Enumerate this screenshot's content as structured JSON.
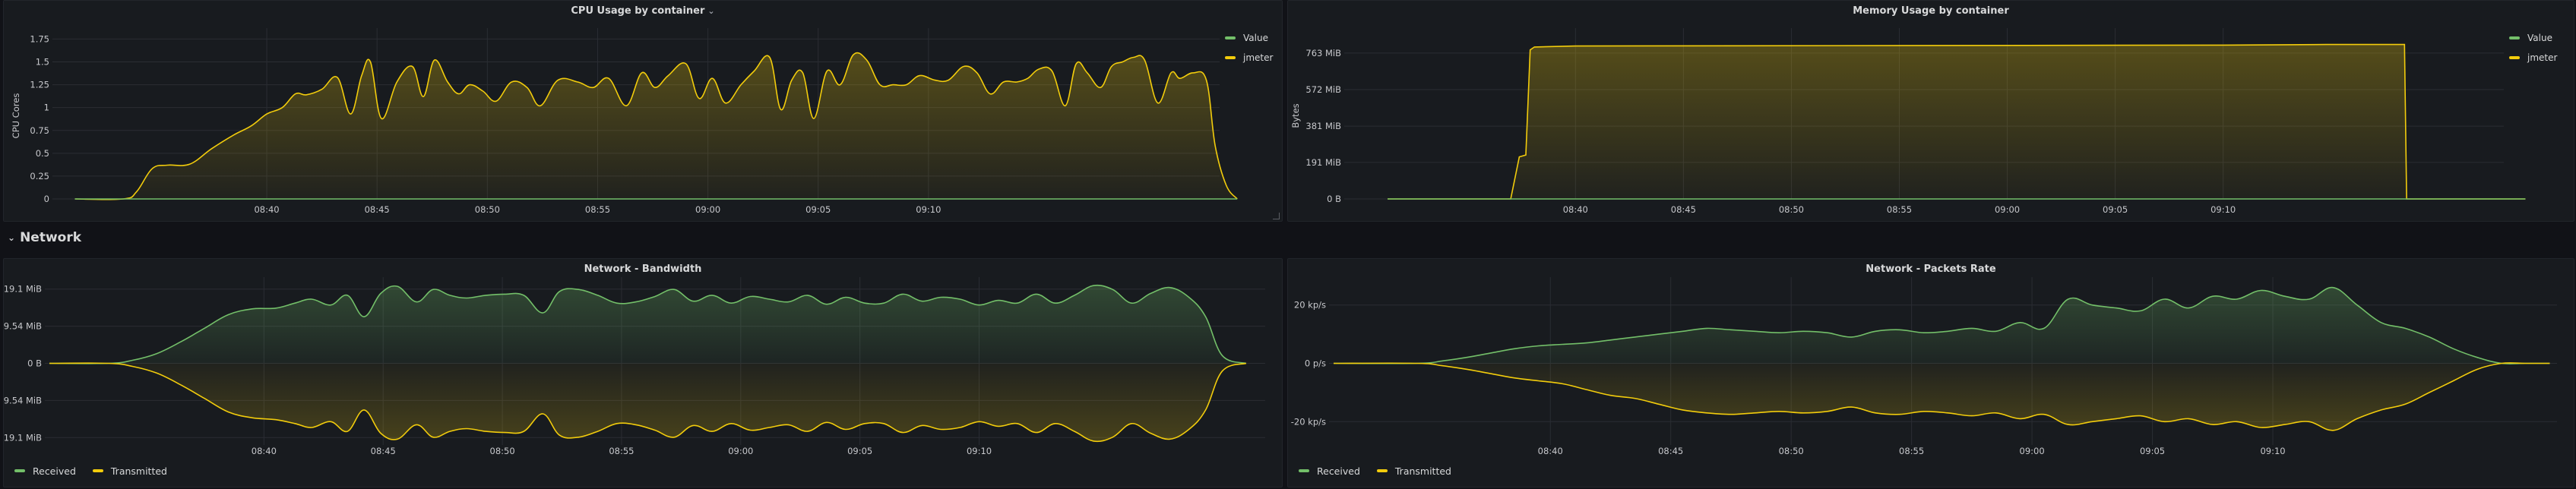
{
  "colors": {
    "green": "#73bf69",
    "yellow": "#f2cc0c",
    "bg": "#111217",
    "panel": "#181b1f"
  },
  "row": {
    "label": "Network",
    "chevron": "⌄"
  },
  "time_ticks": [
    "08:40",
    "08:45",
    "08:50",
    "08:55",
    "09:00",
    "09:05",
    "09:10"
  ],
  "panels": [
    {
      "title": "CPU Usage by container",
      "title_caret": "⌄",
      "ylabel": "CPU Cores",
      "y_ticks": [
        "1.75",
        "1.5",
        "1.25",
        "1",
        "0.75",
        "0.5",
        "0.25",
        "0"
      ],
      "legend": [
        {
          "label": "Value",
          "color": "#73bf69"
        },
        {
          "label": "jmeter",
          "color": "#f2cc0c"
        }
      ]
    },
    {
      "title": "Memory Usage by container",
      "title_caret": "",
      "ylabel": "Bytes",
      "y_ticks": [
        "763 MiB",
        "572 MiB",
        "381 MiB",
        "191 MiB",
        "0 B"
      ],
      "legend": [
        {
          "label": "Value",
          "color": "#73bf69"
        },
        {
          "label": "jmeter",
          "color": "#f2cc0c"
        }
      ]
    },
    {
      "title": "Network - Bandwidth",
      "title_caret": "",
      "ylabel": "",
      "y_ticks": [
        "19.1 MiB",
        "9.54 MiB",
        "0 B",
        "-9.54 MiB",
        "-19.1 MiB"
      ],
      "legend": [
        {
          "label": "Received",
          "color": "#73bf69"
        },
        {
          "label": "Transmitted",
          "color": "#f2cc0c"
        }
      ]
    },
    {
      "title": "Network - Packets Rate",
      "title_caret": "",
      "ylabel": "",
      "y_ticks": [
        "20 kp/s",
        "0 p/s",
        "-20 kp/s"
      ],
      "legend": [
        {
          "label": "Received",
          "color": "#73bf69"
        },
        {
          "label": "Transmitted",
          "color": "#f2cc0c"
        }
      ]
    }
  ],
  "chart_data": [
    {
      "type": "area",
      "title": "CPU Usage by container",
      "ylabel": "CPU Cores",
      "ylim": [
        0,
        1.75
      ],
      "x_minutes_from_0840": [
        -8.7,
        -6.5,
        -5.9,
        -5.2,
        -4.5,
        -3.5,
        -2.5,
        -1.5,
        -0.7,
        0,
        0.7,
        1.3,
        1.8,
        2.5,
        3.2,
        3.8,
        4.3,
        4.7,
        5.2,
        5.9,
        6.6,
        7.1,
        7.6,
        8.2,
        8.7,
        9.2,
        9.8,
        10.4,
        11.1,
        11.8,
        12.4,
        13.2,
        14.1,
        14.8,
        15.5,
        16.3,
        17.0,
        17.6,
        18.2,
        19.0,
        19.6,
        20.2,
        20.8,
        21.5,
        22.1,
        22.8,
        23.3,
        23.8,
        24.3,
        24.8,
        25.4,
        26.0,
        26.6,
        27.2,
        27.8,
        28.4,
        29.0,
        29.6,
        30.3,
        30.9,
        31.6,
        32.2,
        32.8,
        33.4,
        34.0,
        34.5,
        35.0,
        35.6,
        36.2,
        36.7,
        37.2,
        37.8,
        38.3,
        38.8,
        39.3,
        39.8,
        40.4,
        41.0,
        41.4,
        42.0,
        42.6,
        43.0,
        43.5,
        44.0
      ],
      "series": [
        {
          "name": "jmeter",
          "values": [
            0,
            0,
            0.08,
            0.33,
            0.37,
            0.38,
            0.55,
            0.7,
            0.8,
            0.93,
            1.0,
            1.15,
            1.14,
            1.2,
            1.33,
            0.93,
            1.35,
            1.5,
            0.88,
            1.28,
            1.45,
            1.12,
            1.52,
            1.28,
            1.15,
            1.25,
            1.18,
            1.07,
            1.28,
            1.22,
            1.02,
            1.3,
            1.28,
            1.22,
            1.32,
            1.02,
            1.38,
            1.22,
            1.35,
            1.48,
            1.1,
            1.32,
            1.05,
            1.25,
            1.4,
            1.55,
            0.98,
            1.3,
            1.38,
            0.88,
            1.4,
            1.25,
            1.58,
            1.52,
            1.25,
            1.25,
            1.25,
            1.35,
            1.3,
            1.3,
            1.45,
            1.38,
            1.15,
            1.28,
            1.28,
            1.32,
            1.42,
            1.4,
            1.02,
            1.48,
            1.38,
            1.22,
            1.45,
            1.5,
            1.55,
            1.52,
            1.05,
            1.38,
            1.32,
            1.38,
            1.3,
            0.58,
            0.15,
            0
          ]
        },
        {
          "name": "Value",
          "values": [
            0,
            0
          ]
        }
      ]
    },
    {
      "type": "area",
      "title": "Memory Usage by container",
      "ylabel": "Bytes",
      "ylim_mib": [
        0,
        840
      ],
      "x_minutes_from_0840": [
        -8.7,
        -3.0,
        -2.6,
        -2.3,
        -2.1,
        -1.9,
        0,
        30,
        34.8,
        38.3,
        38.4,
        38.5,
        41.0,
        44.0
      ],
      "series": [
        {
          "name": "jmeter",
          "values": [
            0,
            0,
            220,
            230,
            780,
            795,
            800,
            805,
            808,
            808,
            808,
            0,
            0,
            0
          ]
        },
        {
          "name": "Value",
          "values": [
            0,
            0
          ]
        }
      ]
    },
    {
      "type": "area",
      "title": "Network - Bandwidth",
      "ylim_mib": [
        -20,
        20
      ],
      "x_minutes_from_0840": [
        -9.0,
        -6.5,
        -5.5,
        -4.5,
        -3.5,
        -2.5,
        -1.5,
        -0.5,
        0.5,
        1.3,
        2.0,
        2.8,
        3.5,
        4.2,
        4.9,
        5.6,
        6.4,
        7.1,
        7.8,
        8.5,
        9.3,
        10.1,
        10.9,
        11.7,
        12.4,
        13.2,
        14.0,
        14.8,
        15.6,
        16.4,
        17.2,
        18.0,
        18.8,
        19.6,
        20.4,
        21.2,
        22.0,
        22.8,
        23.6,
        24.4,
        25.2,
        26.0,
        26.8,
        27.6,
        28.4,
        29.2,
        30.0,
        30.8,
        31.6,
        32.4,
        33.2,
        34.0,
        34.8,
        35.6,
        36.4,
        37.2,
        38.0,
        38.8,
        39.5,
        40.2,
        41.2
      ],
      "series": [
        {
          "name": "Received",
          "values": [
            0,
            0,
            0.8,
            2.5,
            5.5,
            9.0,
            12.5,
            14.0,
            14.2,
            15.5,
            16.5,
            15.0,
            17.5,
            12.0,
            18.0,
            19.8,
            15.8,
            19.0,
            17.5,
            16.8,
            17.5,
            17.8,
            17.5,
            13.0,
            18.5,
            19.0,
            17.5,
            15.5,
            15.8,
            17.2,
            19.0,
            16.0,
            17.5,
            15.5,
            17.2,
            16.5,
            15.8,
            17.5,
            15.2,
            17.0,
            15.5,
            15.5,
            17.8,
            16.0,
            17.0,
            16.5,
            15.0,
            16.2,
            15.5,
            17.8,
            15.5,
            17.5,
            20.0,
            19.0,
            15.5,
            18.0,
            19.5,
            17.0,
            12.0,
            2.0,
            0
          ]
        },
        {
          "name": "Transmitted",
          "values": [
            0,
            0,
            -0.8,
            -2.5,
            -5.5,
            -9.0,
            -12.5,
            -14.0,
            -14.5,
            -15.5,
            -16.5,
            -15.0,
            -17.5,
            -12.0,
            -18.0,
            -19.5,
            -15.8,
            -19.0,
            -17.5,
            -16.8,
            -17.5,
            -17.8,
            -17.5,
            -13.0,
            -18.5,
            -19.0,
            -17.5,
            -15.5,
            -15.8,
            -17.2,
            -19.0,
            -16.0,
            -17.5,
            -15.5,
            -17.2,
            -16.5,
            -15.8,
            -17.5,
            -15.2,
            -17.0,
            -15.5,
            -15.5,
            -17.8,
            -16.0,
            -17.0,
            -16.5,
            -15.0,
            -16.2,
            -15.5,
            -17.8,
            -15.5,
            -17.5,
            -20.0,
            -19.0,
            -15.5,
            -18.0,
            -19.5,
            -17.0,
            -12.0,
            -2.0,
            0
          ]
        }
      ]
    },
    {
      "type": "area",
      "title": "Network - Packets Rate",
      "ylim_kps": [
        -28,
        28
      ],
      "x_minutes_from_0840": [
        -9.0,
        -5.5,
        -4.5,
        -3.5,
        -2.5,
        -1.5,
        -0.5,
        0.5,
        1.5,
        2.5,
        3.5,
        4.5,
        5.5,
        6.5,
        7.5,
        8.5,
        9.5,
        10.5,
        11.5,
        12.5,
        13.5,
        14.5,
        15.5,
        16.5,
        17.5,
        18.5,
        19.5,
        20.5,
        21.5,
        22.5,
        23.5,
        24.5,
        25.5,
        26.5,
        27.5,
        28.5,
        29.5,
        30.5,
        31.5,
        32.5,
        33.5,
        34.5,
        35.5,
        36.5,
        37.5,
        38.5,
        39.5,
        40.5,
        41.5
      ],
      "series": [
        {
          "name": "Received",
          "values": [
            0,
            0,
            0.8,
            2,
            3.5,
            5,
            6,
            6.5,
            7,
            8,
            9,
            10,
            11,
            12,
            11.5,
            11,
            10.5,
            11,
            10.5,
            9,
            11,
            11.5,
            10.5,
            11,
            12,
            11,
            14,
            12,
            22,
            20,
            19,
            18,
            22,
            19,
            23,
            22,
            25,
            23,
            22,
            26,
            20,
            14,
            12,
            9,
            5,
            2,
            0,
            0,
            0
          ]
        },
        {
          "name": "Transmitted",
          "values": [
            0,
            0,
            -0.8,
            -2,
            -3.5,
            -5,
            -6,
            -7,
            -9,
            -11,
            -12,
            -14,
            -16,
            -17,
            -17.5,
            -17,
            -16.5,
            -17,
            -16.5,
            -15,
            -17,
            -17.5,
            -16.5,
            -17,
            -18,
            -17,
            -19,
            -17.5,
            -21,
            -20,
            -19,
            -18,
            -20,
            -19,
            -21,
            -20,
            -22,
            -21,
            -20,
            -23,
            -19,
            -16,
            -14,
            -10,
            -6,
            -2,
            0,
            0,
            0
          ]
        }
      ]
    }
  ]
}
